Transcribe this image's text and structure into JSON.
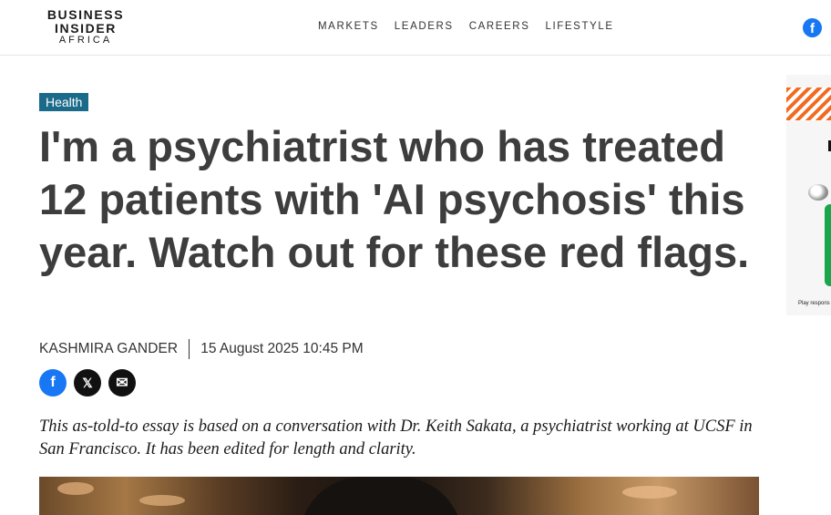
{
  "header": {
    "logo": {
      "line1": "BUSINESS",
      "line2": "INSIDER",
      "line3": "AFRICA"
    },
    "nav": [
      {
        "label": "MARKETS"
      },
      {
        "label": "LEADERS"
      },
      {
        "label": "CAREERS"
      },
      {
        "label": "LIFESTYLE"
      }
    ],
    "facebook_icon": "facebook-icon",
    "facebook_glyph": "f"
  },
  "article": {
    "category": "Health",
    "headline": "I'm a psychiatrist who has treated 12 patients with 'AI psychosis' this year. Watch out for these red flags.",
    "author": "KASHMIRA GANDER",
    "date": "15 August 2025 10:45 PM",
    "share": [
      {
        "icon": "facebook-icon",
        "glyph": "f"
      },
      {
        "icon": "x-icon",
        "glyph": "𝕏"
      },
      {
        "icon": "mail-icon",
        "glyph": "✉"
      }
    ],
    "dek": "This as-told-to essay is based on a conversation with Dr. Keith Sakata, a psychiatrist working at UCSF in San Francisco. It has been edited for length and clarity."
  },
  "ad": {
    "caption": "Play respons"
  },
  "colors": {
    "tag_bg": "#1b6a8a",
    "facebook": "#1877f2",
    "ad_accent": "#f26b21"
  }
}
